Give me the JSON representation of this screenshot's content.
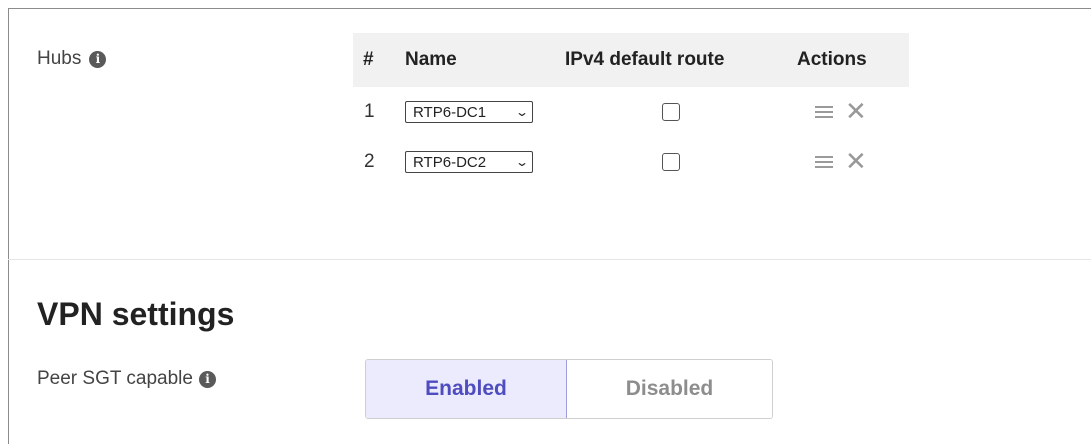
{
  "hubs": {
    "label": "Hubs",
    "info_glyph": "i",
    "table": {
      "headers": {
        "num": "#",
        "name": "Name",
        "ipv4": "IPv4 default route",
        "actions": "Actions"
      },
      "rows": [
        {
          "num": "1",
          "name": "RTP6-DC1",
          "ipv4_default_route": false
        },
        {
          "num": "2",
          "name": "RTP6-DC2",
          "ipv4_default_route": false
        }
      ]
    },
    "icons": {
      "drag": "drag-handle-icon",
      "remove": "close-icon",
      "dropdown": "chevron-down-icon"
    }
  },
  "vpn_settings": {
    "title": "VPN settings",
    "peer_sgt": {
      "label": "Peer SGT capable",
      "info_glyph": "i",
      "options": [
        "Enabled",
        "Disabled"
      ],
      "selected": "Enabled"
    }
  },
  "colors": {
    "toggle_active_bg": "#ecebfd",
    "toggle_active_text": "#4f4cbf",
    "header_bg": "#f1f1f1"
  }
}
